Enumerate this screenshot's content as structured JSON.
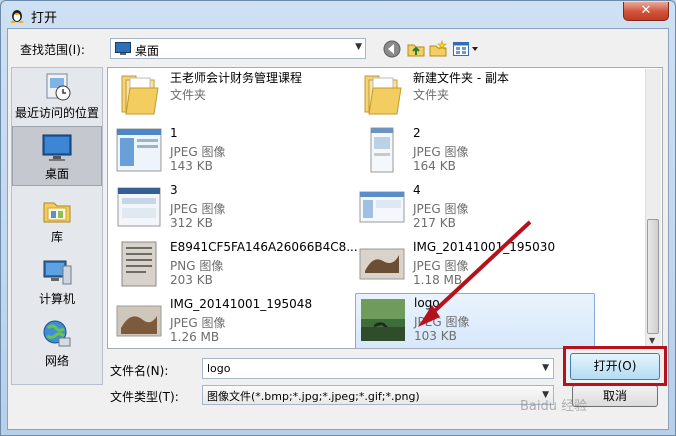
{
  "window": {
    "title": "打开"
  },
  "lookin": {
    "label": "查找范围(I):",
    "value": "桌面"
  },
  "places": [
    {
      "label": "最近访问的位置",
      "icon": "recent-places-icon"
    },
    {
      "label": "桌面",
      "icon": "desktop-icon",
      "selected": true
    },
    {
      "label": "库",
      "icon": "libraries-icon"
    },
    {
      "label": "计算机",
      "icon": "computer-icon"
    },
    {
      "label": "网络",
      "icon": "network-icon"
    }
  ],
  "files": [
    {
      "name": "王老师会计财务管理课程",
      "type": "文件夹",
      "size": ""
    },
    {
      "name": "新建文件夹 - 副本",
      "type": "文件夹",
      "size": ""
    },
    {
      "name": "1",
      "type": "JPEG 图像",
      "size": "143 KB"
    },
    {
      "name": "2",
      "type": "JPEG 图像",
      "size": "164 KB"
    },
    {
      "name": "3",
      "type": "JPEG 图像",
      "size": "312 KB"
    },
    {
      "name": "4",
      "type": "JPEG 图像",
      "size": "217 KB"
    },
    {
      "name": "E8941CF5FA146A26066B4C8...",
      "type": "PNG 图像",
      "size": "203 KB"
    },
    {
      "name": "IMG_20141001_195030",
      "type": "JPEG 图像",
      "size": "1.18 MB"
    },
    {
      "name": "IMG_20141001_195048",
      "type": "JPEG 图像",
      "size": "1.26 MB"
    },
    {
      "name": "logo",
      "type": "JPEG 图像",
      "size": "103 KB",
      "selected": true
    }
  ],
  "filename": {
    "label": "文件名(N):",
    "value": "logo"
  },
  "filetype": {
    "label": "文件类型(T):",
    "value": "图像文件(*.bmp;*.jpg;*.jpeg;*.gif;*.png)"
  },
  "buttons": {
    "open": "打开(O)",
    "cancel": "取消"
  },
  "watermark": "Baidu 经验",
  "colors": {
    "annotation": "#b5121b",
    "selection": "#84acdd"
  }
}
